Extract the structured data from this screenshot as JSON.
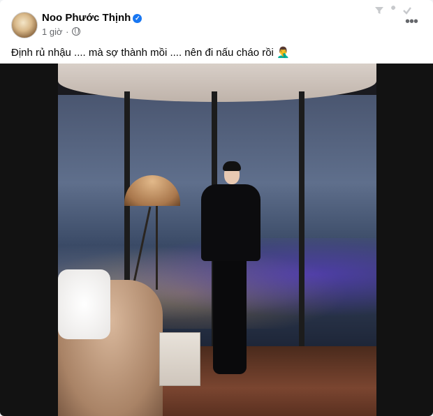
{
  "post": {
    "author": "Noo Phước Thịnh",
    "time": "1 giờ",
    "caption": "Định rủ nhậu .... mà sợ thành mồi .... nên đi nấu cháo rồi 🤦‍♂️",
    "more_label": "•••"
  },
  "icons": {
    "verified": "verified-badge-icon",
    "privacy": "globe-icon",
    "toolbar": [
      "filter-icon",
      "wrench-icon",
      "check-icon"
    ]
  },
  "colors": {
    "brand_blue": "#1877f2",
    "text_primary": "#050505",
    "text_secondary": "#65676b"
  }
}
